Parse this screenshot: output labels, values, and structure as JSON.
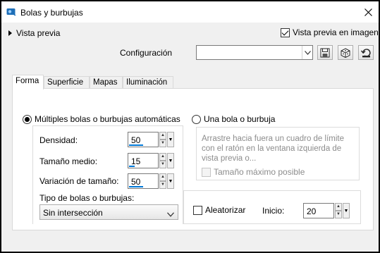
{
  "window": {
    "title": "Bolas y burbujas"
  },
  "header": {
    "preview_toggle_label": "Vista previa",
    "live_preview_label": "Vista previa en imagen",
    "live_preview_checked": true,
    "config_label": "Configuración",
    "config_value": ""
  },
  "tabs": [
    "Forma",
    "Superficie",
    "Mapas",
    "Iluminación"
  ],
  "shape": {
    "mode_multiple_label": "Múltiples bolas o burbujas automáticas",
    "mode_single_label": "Una bola o burbuja",
    "selected_mode": "multiple",
    "density": {
      "label": "Densidad:",
      "value": "50"
    },
    "mean_size": {
      "label": "Tamaño medio:",
      "value": "15"
    },
    "size_variation": {
      "label": "Variación de tamaño:",
      "value": "50"
    },
    "type_label": "Tipo de bolas o burbujas:",
    "type_value": "Sin intersección",
    "single_hint": "Arrastre hacia fuera un cuadro de límite con el ratón en la ventana izquierda de vista previa o...",
    "max_size_label": "Tamaño máximo posible",
    "randomize_label": "Aleatorizar",
    "start_label": "Inicio:",
    "start_value": "20"
  },
  "icons": [
    "app-icon",
    "close-icon",
    "preset-save-icon",
    "preset-random-icon",
    "preset-reset-icon",
    "dropdown-arrow-icon"
  ]
}
